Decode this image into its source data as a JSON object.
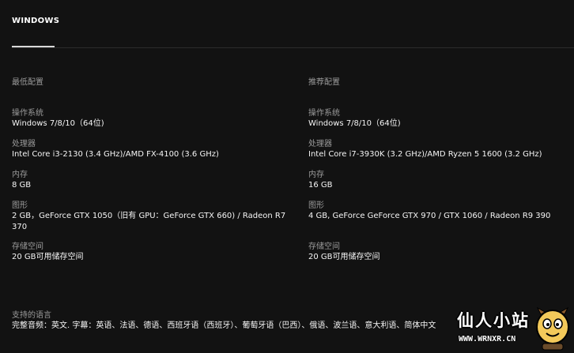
{
  "tabs": {
    "active": "WINDOWS"
  },
  "minimum": {
    "heading": "最低配置",
    "specs": [
      {
        "label": "操作系统",
        "value": "Windows 7/8/10（64位)"
      },
      {
        "label": "处理器",
        "value": "Intel Core i3-2130 (3.4 GHz)/AMD FX-4100 (3.6 GHz)"
      },
      {
        "label": "内存",
        "value": "8 GB"
      },
      {
        "label": "图形",
        "value": "2 GB，GeForce GTX 1050（旧有 GPU：GeForce GTX 660) / Radeon R7",
        "value2": "370"
      },
      {
        "label": "存储空间",
        "value": "20 GB可用储存空间"
      }
    ]
  },
  "recommended": {
    "heading": "推荐配置",
    "specs": [
      {
        "label": "操作系统",
        "value": "Windows 7/8/10（64位)"
      },
      {
        "label": "处理器",
        "value": "Intel Core i7-3930K (3.2 GHz)/AMD Ryzen 5 1600 (3.2 GHz)"
      },
      {
        "label": "内存",
        "value": "16 GB"
      },
      {
        "label": "图形",
        "value": "4 GB, GeForce GeForce GTX 970 / GTX 1060 / Radeon R9 390"
      },
      {
        "label": "存储空间",
        "value": "20 GB可用储存空间"
      }
    ]
  },
  "languages": {
    "label": "支持的语言",
    "value": "完整音频：英文. 字幕：英语、法语、德语、西班牙语（西班牙）、葡萄牙语（巴西）、俄语、波兰语、意大利语、简体中文"
  },
  "watermark": {
    "title": "仙人小站",
    "url": "WWW.WRNXR.CN",
    "mascot_icon": "cartoon-mascot-icon",
    "colors": {
      "text": "#ffffff",
      "outline": "#000000",
      "mascot": "#f3c95a"
    }
  },
  "colors": {
    "background": "#121212",
    "label": "#9b9b9b",
    "value": "#f5f5f5"
  }
}
